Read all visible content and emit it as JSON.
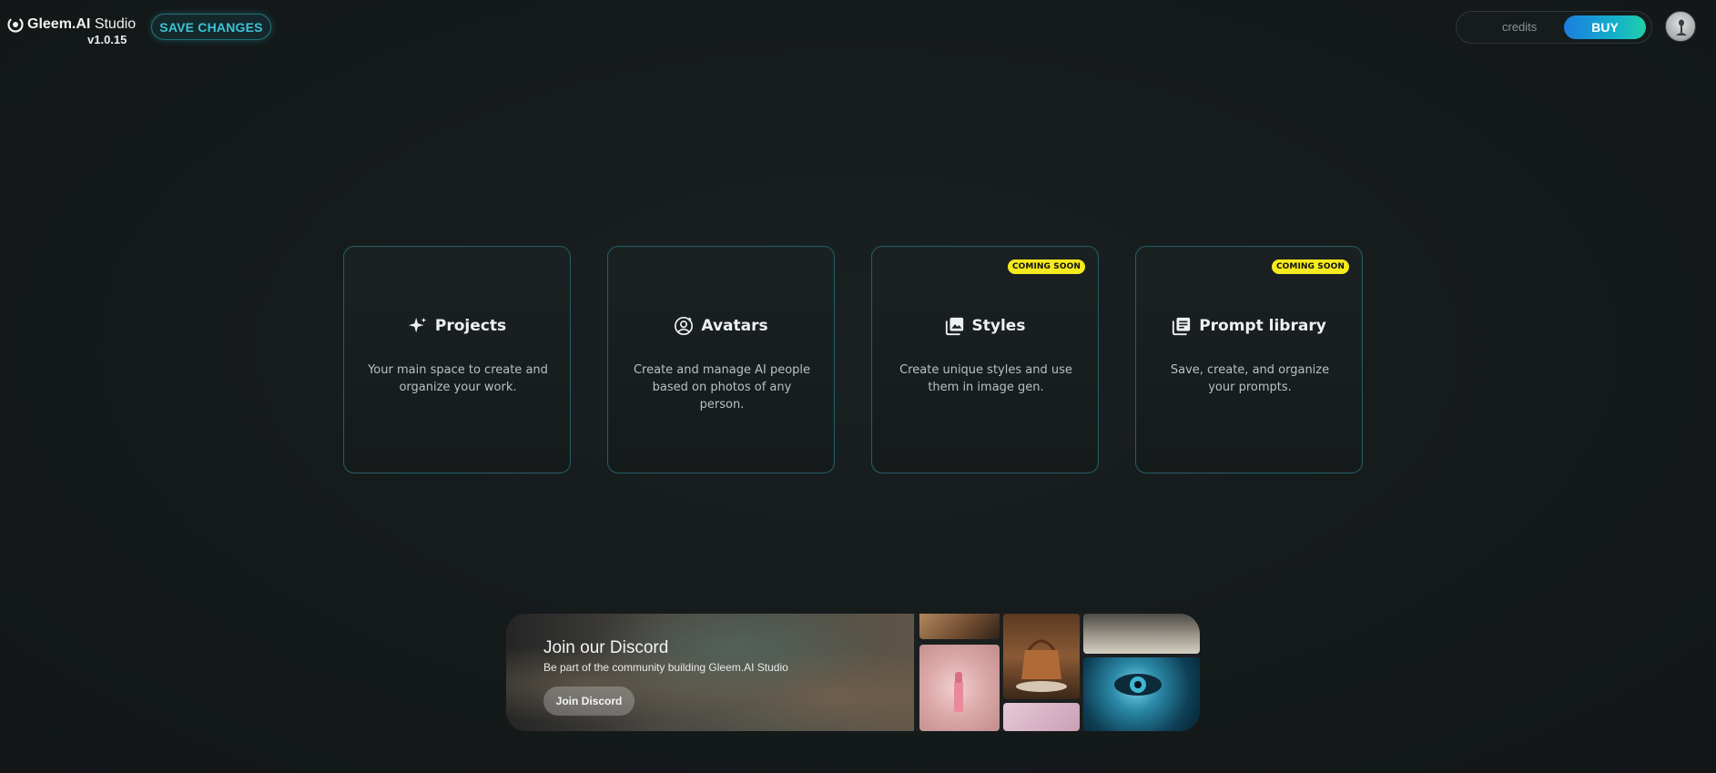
{
  "header": {
    "brand_name": "Gleem.AI",
    "brand_suffix": "Studio",
    "version": "v1.0.15",
    "save_label": "SAVE CHANGES",
    "credits_label": "credits",
    "buy_label": "BUY"
  },
  "cards": [
    {
      "title": "Projects",
      "description": "Your main space to create and organize your work.",
      "icon": "sparkle-icon",
      "badge": ""
    },
    {
      "title": "Avatars",
      "description": "Create and manage AI people based on photos of any person.",
      "icon": "user-circle-icon",
      "badge": ""
    },
    {
      "title": "Styles",
      "description": "Create unique styles and use them in image gen.",
      "icon": "image-stack-icon",
      "badge": "COMING SOON"
    },
    {
      "title": "Prompt library",
      "description": "Save, create, and organize your prompts.",
      "icon": "library-icon",
      "badge": "COMING SOON"
    }
  ],
  "discord": {
    "title": "Join our Discord",
    "subtitle": "Be part of the community building Gleem.AI Studio",
    "button_label": "Join Discord"
  },
  "colors": {
    "accent": "#3cc3d6",
    "badge": "#f4ea1e",
    "card_border": "#1f5f65"
  }
}
